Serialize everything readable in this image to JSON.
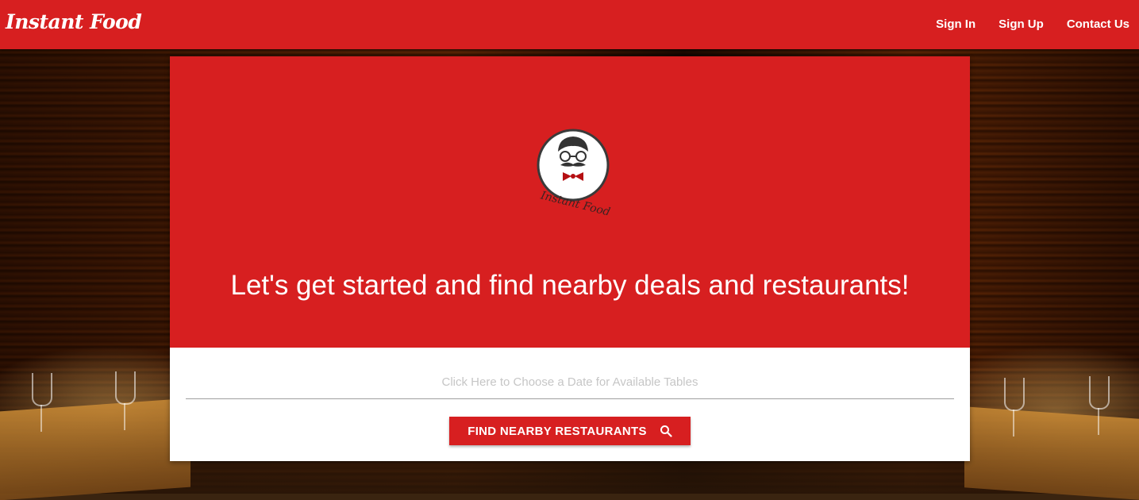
{
  "header": {
    "brand": "Instant Food",
    "nav": [
      "Sign In",
      "Sign Up",
      "Contact Us"
    ]
  },
  "hero": {
    "logo_text": "Instant Food",
    "headline": "Let's get started and find nearby deals and restaurants!"
  },
  "search": {
    "date_placeholder": "Click Here to Choose a Date for Available Tables",
    "button_label": "FIND NEARBY RESTAURANTS"
  },
  "icons": {
    "search": "search-icon"
  },
  "colors": {
    "brand_red": "#d71f20",
    "white": "#ffffff"
  }
}
